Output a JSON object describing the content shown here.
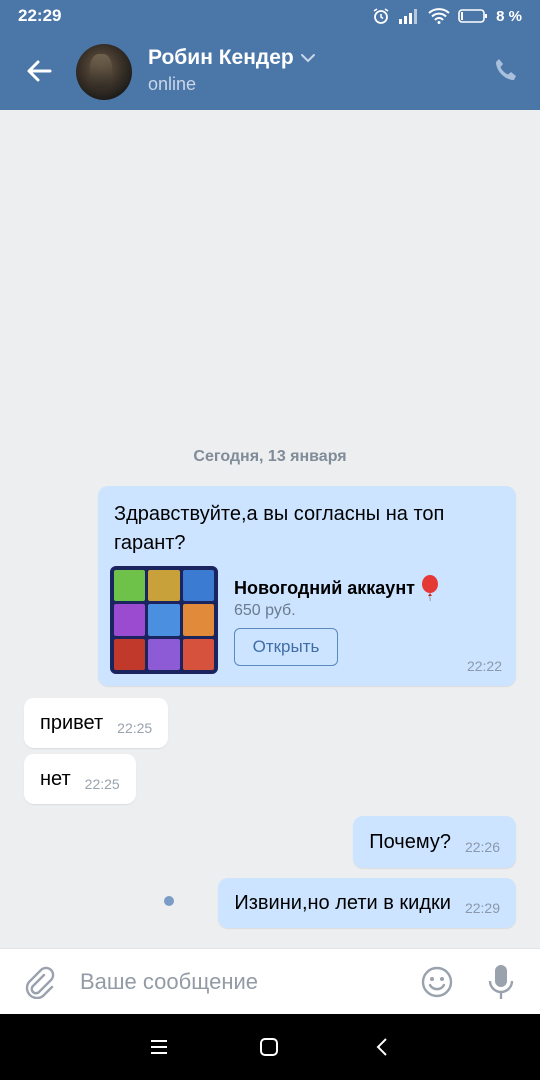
{
  "status_bar": {
    "time": "22:29",
    "battery": "8 %"
  },
  "header": {
    "contact_name": "Робин Кендер",
    "presence": "online"
  },
  "chat": {
    "date_divider": "Сегодня, 13 января",
    "messages": [
      {
        "direction": "out",
        "text": "Здравствуйте,а вы согласны на топ гарант?",
        "time": "22:22",
        "product": {
          "title": "Новогодний аккаунт",
          "price": "650 руб.",
          "button": "Открыть"
        }
      },
      {
        "direction": "in",
        "text": "привет",
        "time": "22:25"
      },
      {
        "direction": "in",
        "text": "нет",
        "time": "22:25"
      },
      {
        "direction": "out",
        "text": "Почему?",
        "time": "22:26"
      },
      {
        "direction": "out",
        "text": "Извини,но лети в кидки",
        "time": "22:29",
        "state": "unread"
      }
    ]
  },
  "composer": {
    "placeholder": "Ваше сообщение"
  },
  "colors": {
    "brand": "#4a76a8",
    "outgoing_bubble": "#cce4ff",
    "incoming_bubble": "#ffffff",
    "background": "#edeef0"
  },
  "icons": [
    "back-arrow-icon",
    "chevron-down-icon",
    "phone-icon",
    "paperclip-icon",
    "smile-icon",
    "microphone-icon",
    "balloon-icon",
    "alarm-icon",
    "signal-icon",
    "wifi-icon",
    "battery-icon",
    "menu-icon",
    "home-icon",
    "back-icon"
  ]
}
